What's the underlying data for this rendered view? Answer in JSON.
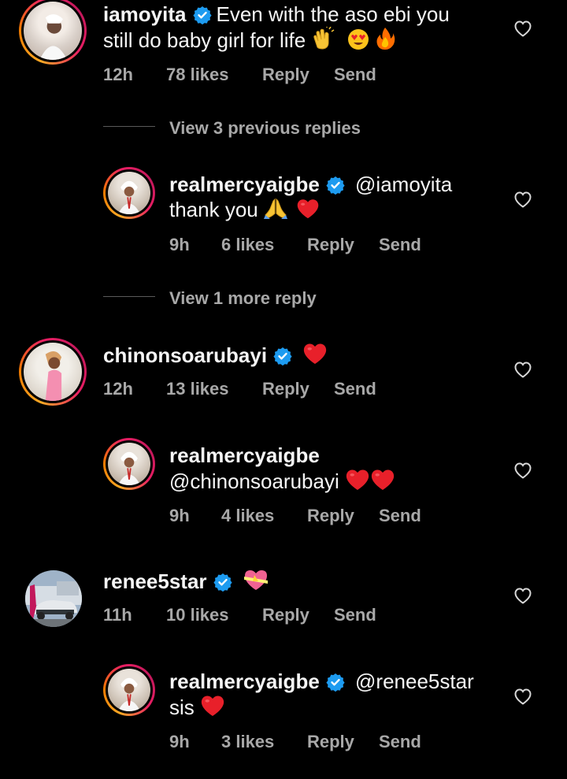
{
  "colors": {
    "background": "#000000",
    "text": "#f5f5f5",
    "muted": "#a8a8a8",
    "verified": "#1d9bf0",
    "heart_emoji": "#e8202a"
  },
  "icons": {
    "verified": "verified-badge-icon",
    "like": "heart-outline-icon",
    "red_heart": "red-heart-emoji",
    "clap": "clapping-hands-emoji",
    "heart_eyes": "heart-eyes-emoji",
    "fire": "fire-emoji",
    "pray": "folded-hands-emoji",
    "gift_heart": "heart-with-ribbon-emoji"
  },
  "comments": [
    {
      "username": "iamoyita",
      "text_line1": "Even with the aso ebi you",
      "text_line2": "still do baby girl for life",
      "time": "12h",
      "likes": "78 likes",
      "reply": "Reply",
      "send": "Send"
    },
    {
      "username": "chinonsoarubayi",
      "time": "12h",
      "likes": "13 likes",
      "reply": "Reply",
      "send": "Send"
    },
    {
      "username": "renee5star",
      "time": "11h",
      "likes": "10 likes",
      "reply": "Reply",
      "send": "Send"
    }
  ],
  "view_links": {
    "previous": "View 3 previous replies",
    "more": "View 1 more reply"
  },
  "replies": [
    {
      "username": "realmercyaigbe",
      "mention": "@iamoyita",
      "text": "thank you",
      "time": "9h",
      "likes": "6 likes",
      "reply": "Reply",
      "send": "Send"
    },
    {
      "username": "realmercyaigbe",
      "mention": "@chinonsoarubayi",
      "time": "9h",
      "likes": "4 likes",
      "reply": "Reply",
      "send": "Send"
    },
    {
      "username": "realmercyaigbe",
      "mention": "@renee5star",
      "text": "sis",
      "time": "9h",
      "likes": "3 likes",
      "reply": "Reply",
      "send": "Send"
    }
  ]
}
